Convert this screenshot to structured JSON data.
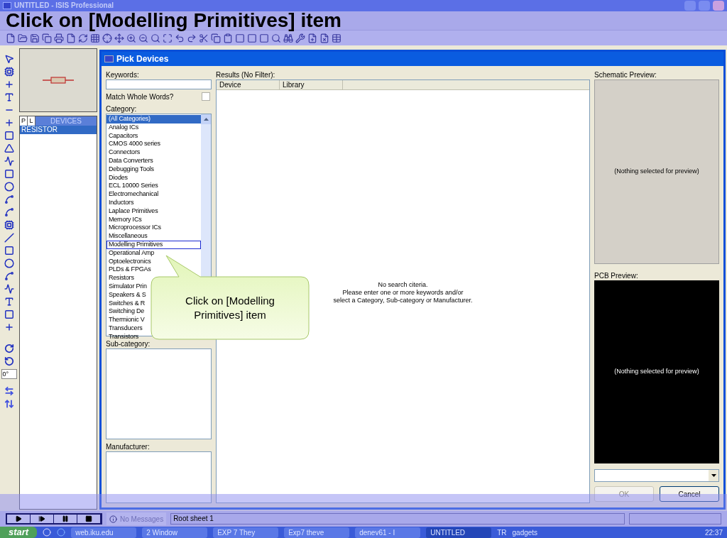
{
  "window": {
    "title": "UNTITLED - ISIS Professional"
  },
  "slide_title": "Click on [Modelling Primitives] item",
  "rotation_field": {
    "value": "0°"
  },
  "device_selector": {
    "tabs": [
      {
        "label": "P",
        "selected": false
      },
      {
        "label": "L",
        "selected": false
      }
    ],
    "header": "DEVICES",
    "devices": [
      {
        "name": "RESISTOR",
        "selected": true
      }
    ]
  },
  "dialog": {
    "title": "Pick Devices",
    "keywords": {
      "label": "Keywords:"
    },
    "match_whole_words": {
      "label": "Match Whole Words?",
      "checked": false
    },
    "category": {
      "label": "Category:",
      "items": [
        {
          "label": "(All Categories)",
          "selected": true,
          "focused": false
        },
        {
          "label": "Analog ICs",
          "selected": false,
          "focused": false
        },
        {
          "label": "Capacitors",
          "selected": false,
          "focused": false
        },
        {
          "label": "CMOS 4000 series",
          "selected": false,
          "focused": false
        },
        {
          "label": "Connectors",
          "selected": false,
          "focused": false
        },
        {
          "label": "Data Converters",
          "selected": false,
          "focused": false
        },
        {
          "label": "Debugging Tools",
          "selected": false,
          "focused": false
        },
        {
          "label": "Diodes",
          "selected": false,
          "focused": false
        },
        {
          "label": "ECL 10000 Series",
          "selected": false,
          "focused": false
        },
        {
          "label": "Electromechanical",
          "selected": false,
          "focused": false
        },
        {
          "label": "Inductors",
          "selected": false,
          "focused": false
        },
        {
          "label": "Laplace Primitives",
          "selected": false,
          "focused": false
        },
        {
          "label": "Memory ICs",
          "selected": false,
          "focused": false
        },
        {
          "label": "Microprocessor ICs",
          "selected": false,
          "focused": false
        },
        {
          "label": "Miscellaneous",
          "selected": false,
          "focused": false
        },
        {
          "label": "Modelling Primitives",
          "selected": false,
          "focused": true
        },
        {
          "label": "Operational Amp",
          "selected": false,
          "focused": false
        },
        {
          "label": "Optoelectronics",
          "selected": false,
          "focused": false
        },
        {
          "label": "PLDs & FPGAs",
          "selected": false,
          "focused": false
        },
        {
          "label": "Resistors",
          "selected": false,
          "focused": false
        },
        {
          "label": "Simulator Prin",
          "selected": false,
          "focused": false
        },
        {
          "label": "Speakers & S",
          "selected": false,
          "focused": false
        },
        {
          "label": "Switches & R",
          "selected": false,
          "focused": false
        },
        {
          "label": "Switching De",
          "selected": false,
          "focused": false
        },
        {
          "label": "Thermionic V",
          "selected": false,
          "focused": false
        },
        {
          "label": "Transducers",
          "selected": false,
          "focused": false
        },
        {
          "label": "Transistors",
          "selected": false,
          "focused": false
        }
      ]
    },
    "sub_category": {
      "label": "Sub-category:"
    },
    "manufacturer": {
      "label": "Manufacturer:"
    },
    "results": {
      "label": "Results (No Filter):",
      "columns": [
        "Device",
        "Library"
      ],
      "message": [
        "No search citeria.",
        "Please enter one or more keywords and/or",
        "select a Category, Sub-category or Manufacturer."
      ]
    },
    "schematic_preview": {
      "label": "Schematic Preview:",
      "text": "(Nothing selected for preview)"
    },
    "pcb_preview": {
      "label": "PCB Preview:",
      "text": "(Nothing selected for preview)"
    },
    "buttons": [
      {
        "label": "OK",
        "disabled": true
      },
      {
        "label": "Cancel",
        "disabled": false
      }
    ]
  },
  "callout": {
    "text": "Click on [Modelling Primitives] item"
  },
  "status_bar": {
    "message": "No Messages",
    "sheet": "Root sheet 1"
  },
  "taskbar": {
    "start": "start",
    "tasks": [
      {
        "label": "web.iku.edu",
        "selected": false
      },
      {
        "label": "2 Window",
        "selected": false
      },
      {
        "label": "EXP 7 They",
        "selected": false
      },
      {
        "label": "Exp7 theve",
        "selected": false
      },
      {
        "label": "denev61 - I",
        "selected": false
      },
      {
        "label": "UNTITLED",
        "selected": true
      }
    ],
    "language": "TR",
    "gadgets": "gadgets",
    "clock": "22:37"
  }
}
